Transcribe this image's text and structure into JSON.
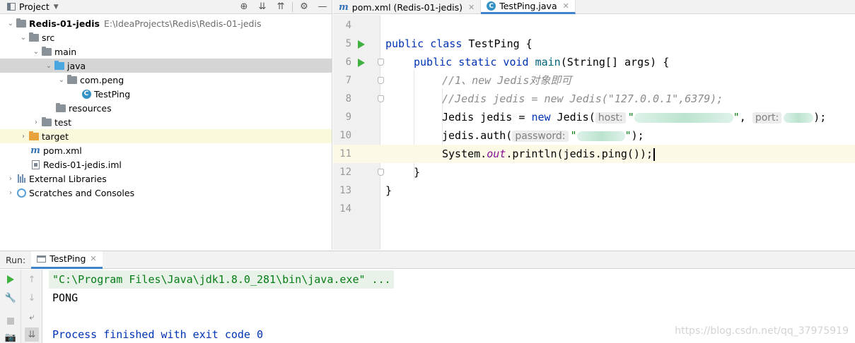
{
  "project_panel": {
    "title": "Project",
    "tree": [
      {
        "label": "Redis-01-jedis",
        "path": "E:\\IdeaProjects\\Redis\\Redis-01-jedis"
      },
      {
        "label": "src"
      },
      {
        "label": "main"
      },
      {
        "label": "java"
      },
      {
        "label": "com.peng"
      },
      {
        "label": "TestPing"
      },
      {
        "label": "resources"
      },
      {
        "label": "test"
      },
      {
        "label": "target"
      },
      {
        "label": "pom.xml"
      },
      {
        "label": "Redis-01-jedis.iml"
      },
      {
        "label": "External Libraries"
      },
      {
        "label": "Scratches and Consoles"
      }
    ]
  },
  "editor_tabs": [
    {
      "label": "pom.xml (Redis-01-jedis)"
    },
    {
      "label": "TestPing.java"
    }
  ],
  "editor": {
    "line_numbers": [
      "4",
      "5",
      "6",
      "7",
      "8",
      "9",
      "10",
      "11",
      "12",
      "13",
      "14"
    ],
    "code": {
      "l5": {
        "kw": "public class",
        "rest": " TestPing {"
      },
      "l6": {
        "kw": "public static void",
        "fn": "main",
        "rest": "(String[] args) {"
      },
      "l7": "//1、new Jedis对象即可",
      "l8": "//Jedis jedis = new Jedis(\"127.0.0.1\",6379);",
      "l9": {
        "pre": "Jedis jedis = ",
        "kw": "new",
        "call": " Jedis(",
        "hint_host": "host:",
        "str_open": "\"",
        "str_close": "\"",
        "comma": ", ",
        "hint_port": "port:",
        "end": ");"
      },
      "l10": {
        "pre": "jedis.auth(",
        "hint_password": "password:",
        "str_open": "\"",
        "str_close": "\"",
        "end": ");"
      },
      "l11": {
        "pre": "System.",
        "field": "out",
        "rest": ".println(jedis.ping());"
      },
      "l12": "}",
      "l13": "}"
    }
  },
  "run_panel": {
    "label": "Run:",
    "tab": "TestPing",
    "console": [
      "\"C:\\Program Files\\Java\\jdk1.8.0_281\\bin\\java.exe\" ...",
      "PONG",
      "",
      "Process finished with exit code 0"
    ]
  },
  "watermark": "https://blog.csdn.net/qq_37975919",
  "colors": {
    "keyword": "#0033b3",
    "comment": "#8c8c8c",
    "string": "#067d17",
    "static_field": "#871094",
    "selection": "#d5d5d5",
    "current_line": "#fcfae6",
    "run_green": "#3fb13f"
  },
  "icons": [
    "project-view-icon",
    "dropdown-arrow-icon",
    "locate-icon",
    "expand-all-icon",
    "collapse-all-icon",
    "gear-icon",
    "minimize-icon",
    "folder-icon",
    "maven-icon",
    "java-class-icon",
    "run-gutter-icon",
    "fold-icon",
    "rerun-icon",
    "wrench-icon",
    "stop-icon",
    "up-arrow-icon",
    "down-arrow-icon",
    "soft-wrap-icon",
    "scroll-to-end-icon"
  ]
}
